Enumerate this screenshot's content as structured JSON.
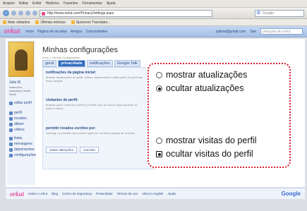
{
  "browser": {
    "menu": [
      "Arquivo",
      "Editar",
      "Exibir",
      "Histórico",
      "Favoritos",
      "Ferramentas",
      "Ajuda"
    ],
    "url": "http://www.orkut.com/PrivacySettings.aspx",
    "search_placeholder": "Google",
    "bookmarks": [
      "Mais visitados",
      "Últimas notícias",
      "Sponsors Translator..."
    ]
  },
  "orkut": {
    "logo": "orkut",
    "nav": [
      "Início",
      "Página de recados",
      "Amigos",
      "Comunidades"
    ],
    "user": "juliana@gmail.com",
    "sair": "Sair",
    "search_placeholder": "pesquisa do orkut"
  },
  "sidebar": {
    "name": "Julia M.",
    "info": "masculino, casado(a), Brasil, Brasil",
    "links": [
      "editar perfil",
      "perfil",
      "recados",
      "álbum",
      "vídeos",
      "listas",
      "mensagens",
      "depoimentos",
      "configurações"
    ]
  },
  "main": {
    "title": "Minhas configurações",
    "breadcrumb": "Início > Minhas configurações",
    "tabs": [
      "geral",
      "privacidade",
      "notificações",
      "Google Talk"
    ],
    "active_tab": "privacidade",
    "sections": [
      {
        "title": "notificações da página inicial:",
        "desc": "Mostrar atualizações do perfil, vídeos, depoimentos e alterações do perfil aos meus amigos"
      },
      {
        "title": "visitantes do perfil:",
        "desc": "mostrar quem visita meu perfil (e permitir que os outros vejam quando eu visito o deles)"
      },
      {
        "title": "permitir recados escritos por:",
        "desc": "restringir os recados que podem aparecer na minha página de recados"
      }
    ],
    "save_button": "salvar alterações",
    "cancel_button": "cancelar"
  },
  "callout": {
    "option1": "mostrar atualizações",
    "option2": "ocultar atualizações",
    "option3": "mostrar visitas do perfil",
    "option4": "ocultar visitas do perfil"
  },
  "footer": {
    "logo": "orkut",
    "links": [
      "Sobre o orkut",
      "Blog",
      "Centro de segurança",
      "Privacidade",
      "Termos de uso",
      "orkut in english",
      "Ajuda"
    ],
    "google": "Google"
  },
  "colors": {
    "accent": "#d51e2a",
    "orkut_pink": "#e94ea0",
    "orkut_blue": "#2b4d86"
  }
}
